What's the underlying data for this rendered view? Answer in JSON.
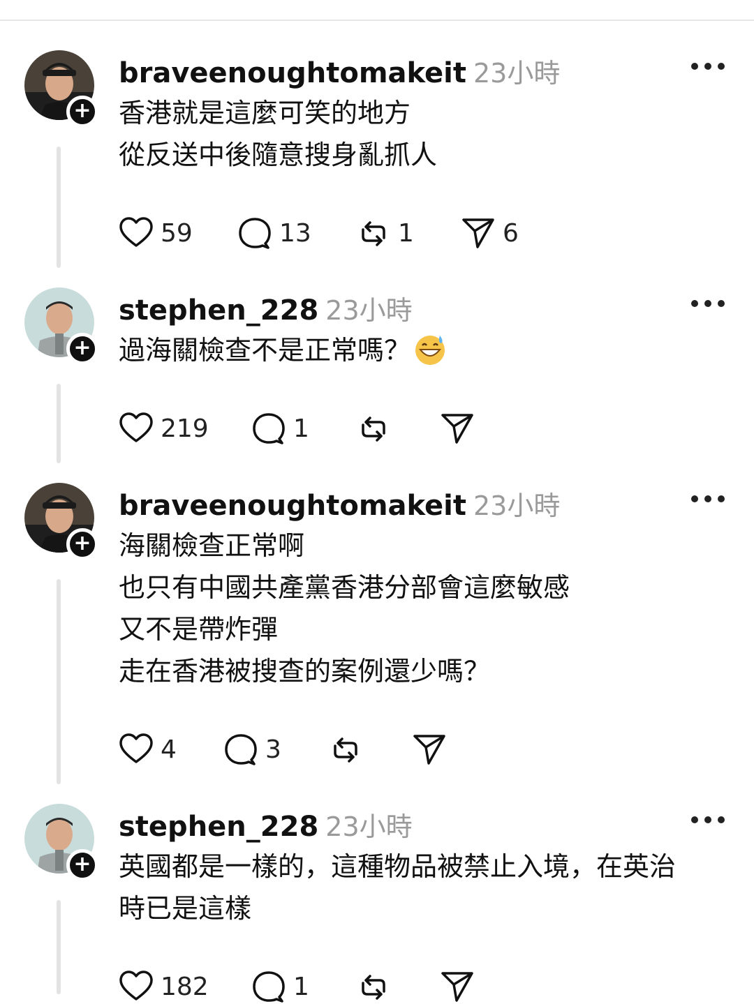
{
  "posts": [
    {
      "username": "braveenoughtomakeit",
      "time": "23小時",
      "lines": [
        "香港就是這麼可笑的地方",
        "從反送中後隨意搜身亂抓人"
      ],
      "likes": "59",
      "replies": "13",
      "reposts": "1",
      "shares": "6",
      "avatar": "avatar-cap-man"
    },
    {
      "username": "stephen_228",
      "time": "23小時",
      "lines": [
        "過海關檢查不是正常嗎？"
      ],
      "emoji": "grinning-face-with-sweat",
      "likes": "219",
      "replies": "1",
      "reposts": "",
      "shares": "",
      "avatar": "avatar-gray-shirt-man"
    },
    {
      "username": "braveenoughtomakeit",
      "time": "23小時",
      "lines": [
        "海關檢查正常啊",
        "也只有中國共產黨香港分部會這麼敏感",
        "又不是帶炸彈",
        "走在香港被搜查的案例還少嗎？"
      ],
      "likes": "4",
      "replies": "3",
      "reposts": "",
      "shares": "",
      "avatar": "avatar-cap-man"
    },
    {
      "username": "stephen_228",
      "time": "23小時",
      "lines": [
        "英國都是一樣的，這種物品被禁止入境，在英治",
        "時已是這樣"
      ],
      "likes": "182",
      "replies": "1",
      "reposts": "",
      "shares": "",
      "avatar": "avatar-gray-shirt-man"
    }
  ],
  "icons": {
    "like": "heart-icon",
    "reply": "comment-icon",
    "repost": "repost-icon",
    "share": "send-icon",
    "more": "more-options-icon",
    "follow": "plus-icon"
  },
  "colors": {
    "text": "#111111",
    "meta": "#9a9a9a",
    "thread": "#e3e3e3",
    "badge": "#101010"
  }
}
